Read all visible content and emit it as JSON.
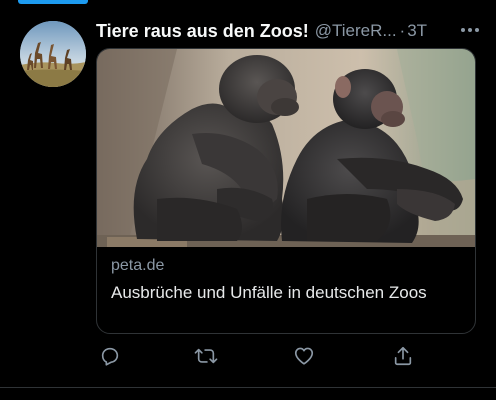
{
  "tweet": {
    "display_name": "Tiere raus aus den Zoos!",
    "handle": "@TiereR...",
    "separator": "·",
    "time": "3T",
    "more_icon": "more-horizontal-icon",
    "avatar_icon": "giraffes-avatar"
  },
  "card": {
    "domain": "peta.de",
    "title": "Ausbrüche und Unfälle in deutschen Zoos",
    "image_subject": "chimpanzees-photo"
  },
  "actions": {
    "reply_icon": "reply-icon",
    "retweet_icon": "retweet-icon",
    "like_icon": "heart-icon",
    "share_icon": "share-icon"
  },
  "colors": {
    "background": "#000000",
    "text_primary": "#e7e9ea",
    "text_secondary": "#8b98a5",
    "border": "#2f3336",
    "accent": "#1d9bf0"
  }
}
